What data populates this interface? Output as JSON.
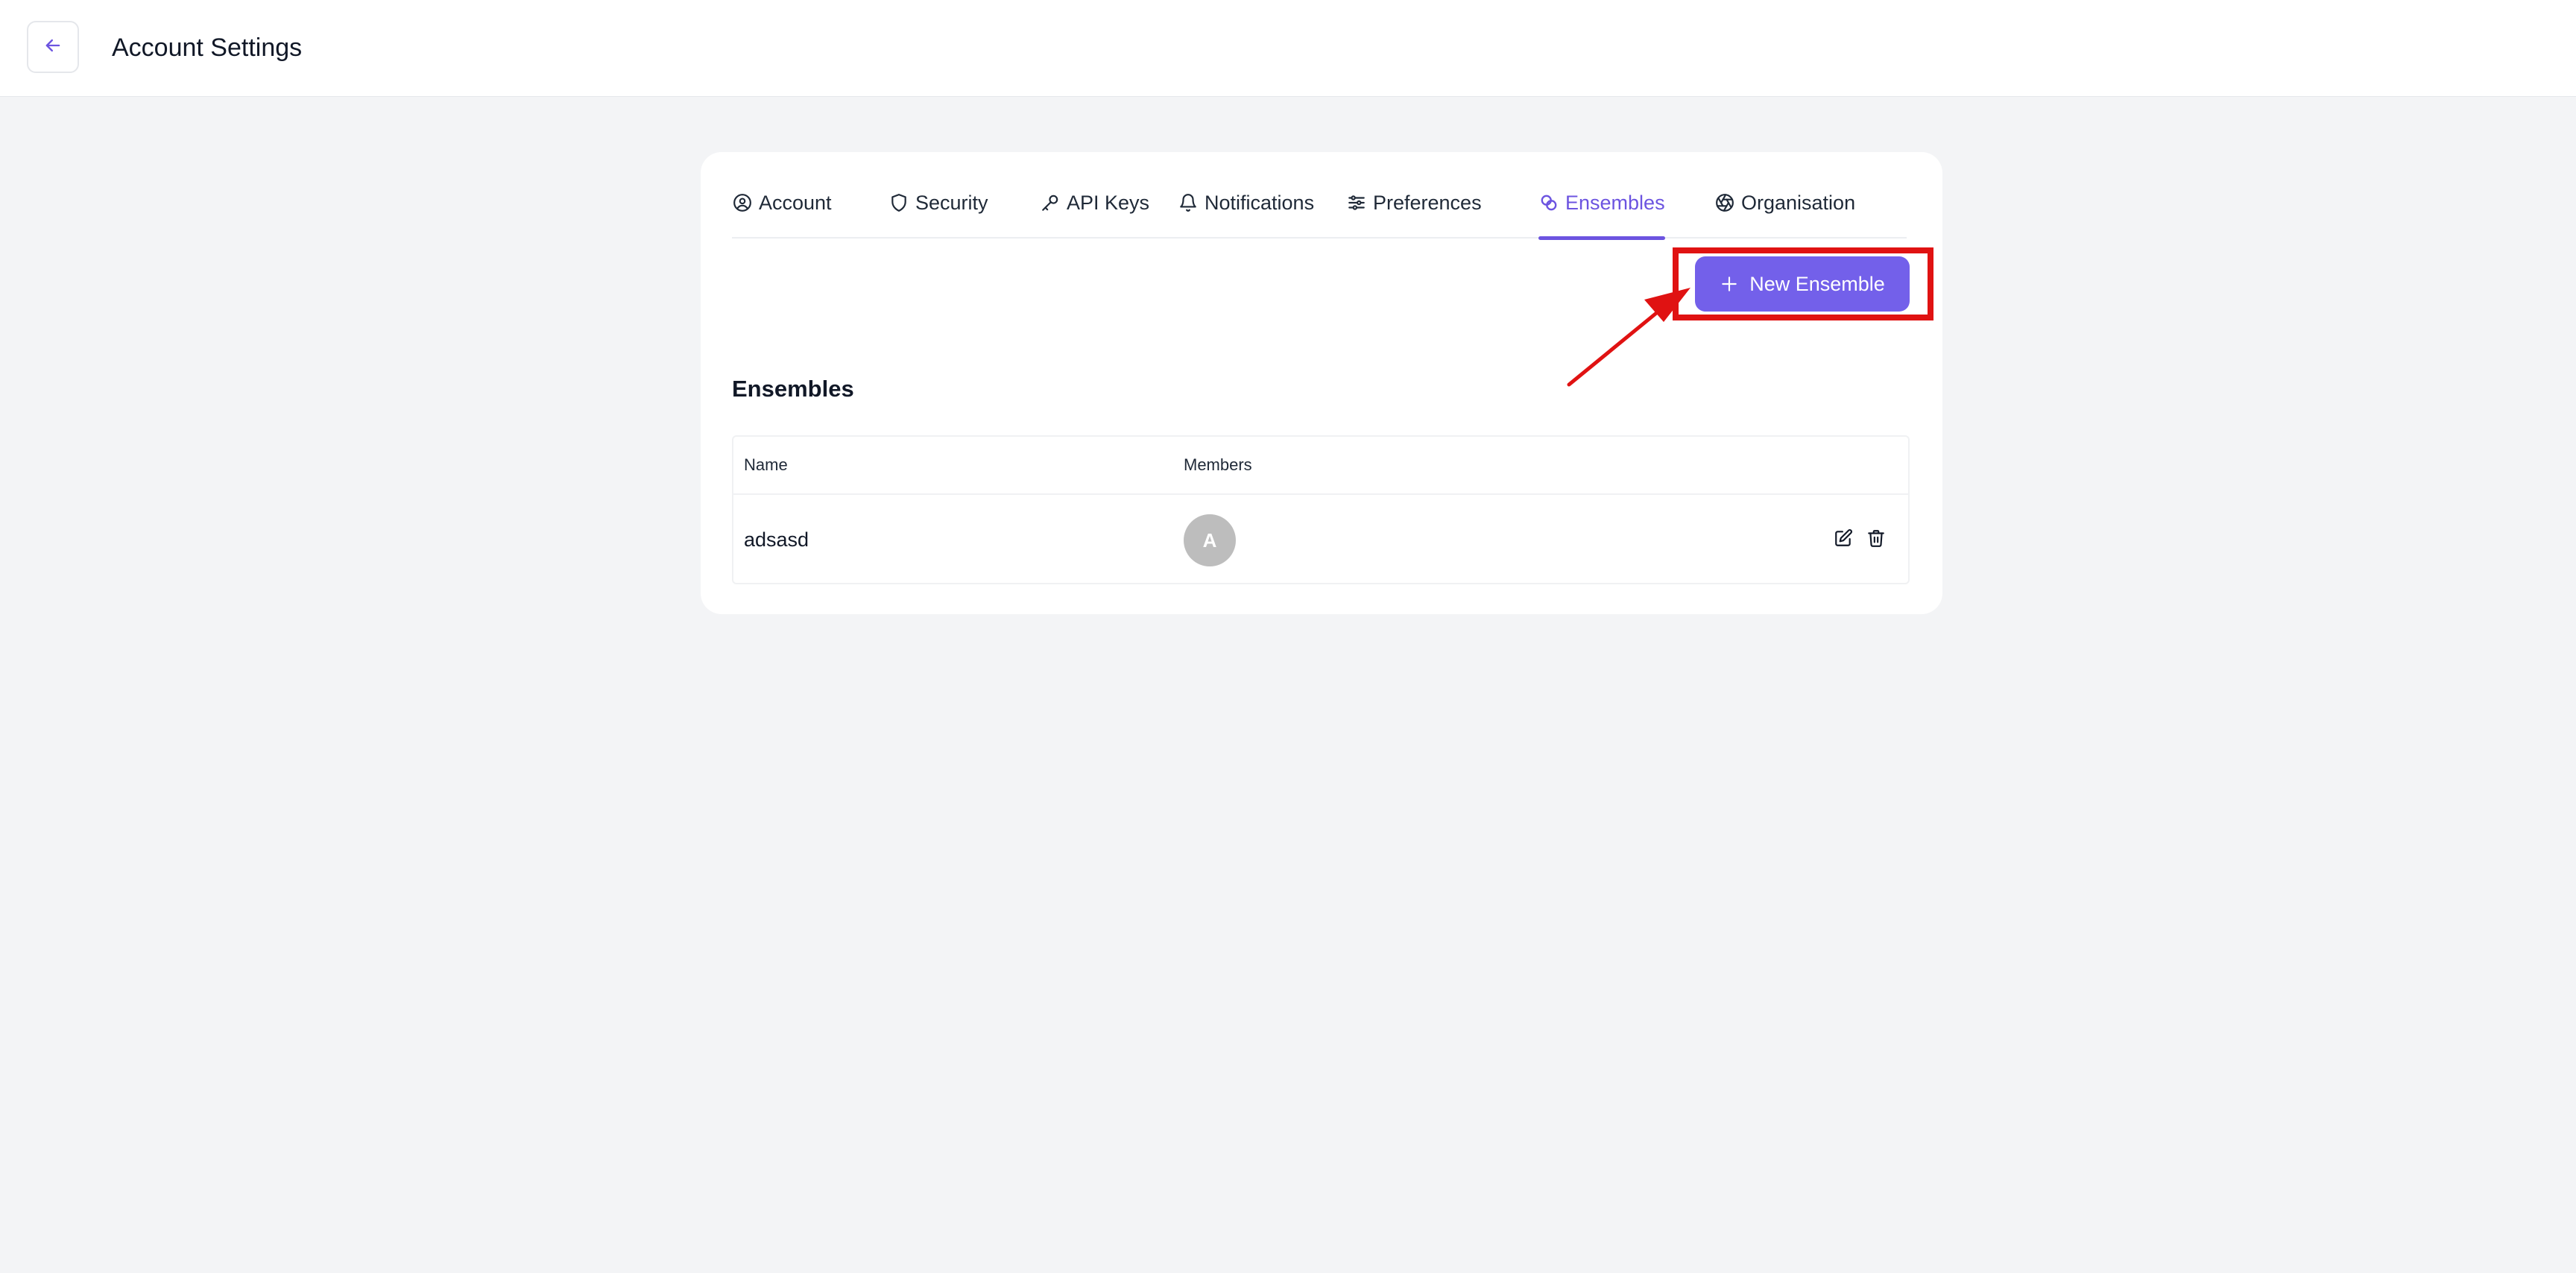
{
  "header": {
    "title": "Account Settings",
    "back_icon": "arrow-left-icon"
  },
  "tabs": [
    {
      "label": "Account",
      "icon": "user-circle-icon",
      "active": false
    },
    {
      "label": "Security",
      "icon": "shield-icon",
      "active": false
    },
    {
      "label": "API Keys",
      "icon": "key-icon",
      "active": false
    },
    {
      "label": "Notifications",
      "icon": "bell-icon",
      "active": false
    },
    {
      "label": "Preferences",
      "icon": "sliders-icon",
      "active": false
    },
    {
      "label": "Ensembles",
      "icon": "link-circles-icon",
      "active": true
    },
    {
      "label": "Organisation",
      "icon": "aperture-icon",
      "active": false
    }
  ],
  "actions": {
    "new_ensemble_label": "New Ensemble",
    "new_ensemble_icon": "plus-icon"
  },
  "section": {
    "title": "Ensembles"
  },
  "table": {
    "columns": [
      "Name",
      "Members"
    ],
    "rows": [
      {
        "name": "adsasd",
        "member_initial": "A"
      }
    ]
  },
  "colors": {
    "accent": "#7360ea",
    "active_tab": "#6c54e0",
    "annotation": "#e01212",
    "page_bg": "#f3f4f6",
    "avatar_bg": "#bdbdbd"
  }
}
